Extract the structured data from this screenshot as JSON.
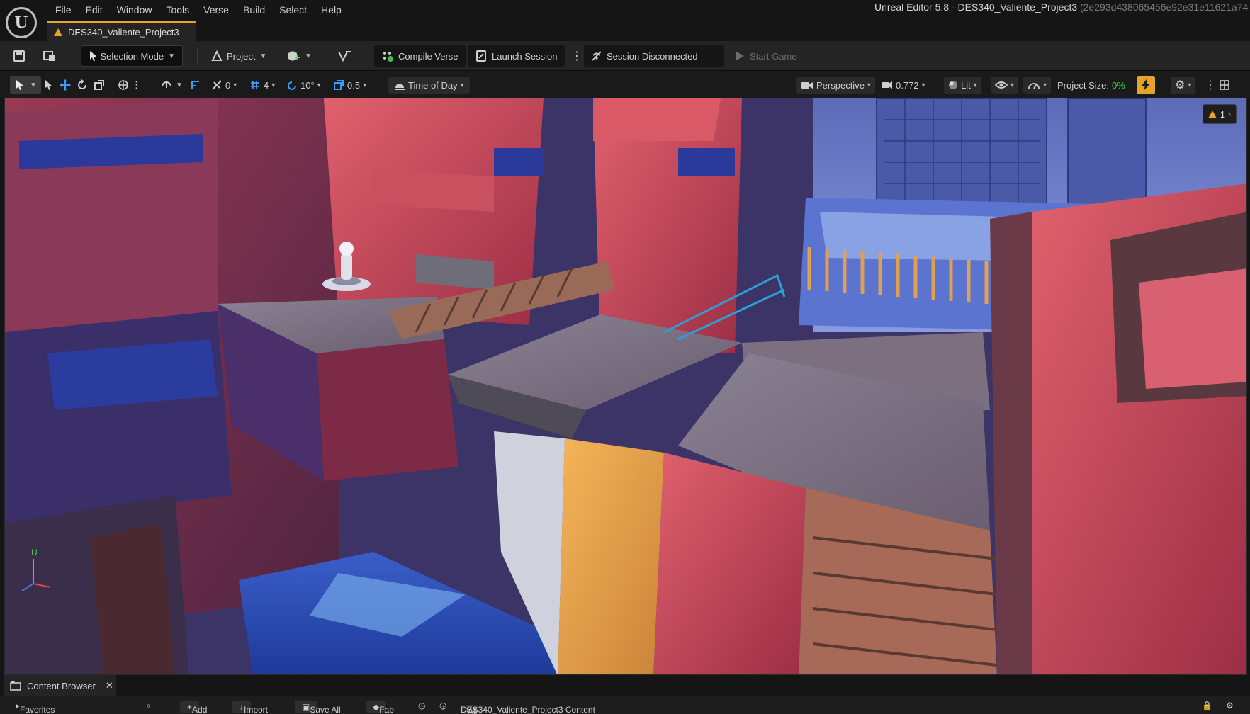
{
  "menu": {
    "items": [
      "File",
      "Edit",
      "Window",
      "Tools",
      "Verse",
      "Build",
      "Select",
      "Help"
    ]
  },
  "window": {
    "title": "Unreal Editor 5.8 - DES340_Valiente_Project3",
    "hash": "(2e293d438065456e92e31e11621a74"
  },
  "document_tab": {
    "label": "DES340_Valiente_Project3"
  },
  "toolbar": {
    "selection_mode": "Selection Mode",
    "project": "Project",
    "compile_verse": "Compile Verse",
    "launch_session": "Launch Session",
    "session_status": "Session Disconnected",
    "start_game": "Start Game"
  },
  "viewport_toolbar": {
    "rotation_snap_value": "0",
    "grid_snap_value": "4",
    "angle_snap_value": "10°",
    "scale_snap_value": "0.5",
    "time_of_day": "Time of Day",
    "perspective": "Perspective",
    "camera_speed": "0.772",
    "lit": "Lit",
    "project_size_label": "Project Size:",
    "project_size_value": "0%"
  },
  "viewport": {
    "warning_count": "1",
    "axis_u": "U",
    "axis_l": "L"
  },
  "content_browser": {
    "tab_label": "Content Browser",
    "favorites": "Favorites",
    "add": "Add",
    "import": "Import",
    "save_all": "Save All",
    "fab": "Fab",
    "path_all": "All",
    "path_content": "DES340_Valiente_Project3 Content"
  },
  "colors": {
    "accent_orange": "#e6a32a",
    "project_size_green": "#38d13c",
    "snap_blue": "#3b9cff"
  }
}
